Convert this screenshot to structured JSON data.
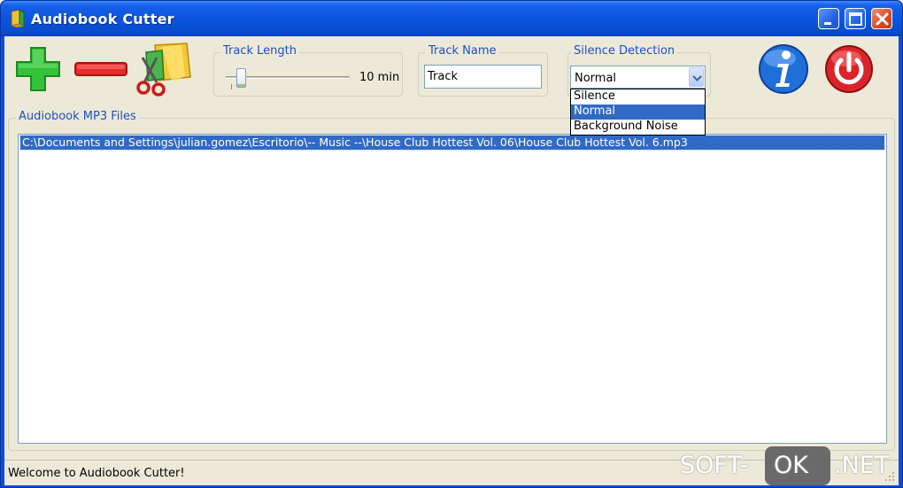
{
  "window": {
    "title": "Audiobook Cutter"
  },
  "toolbar": {
    "add_icon": "plus-icon",
    "remove_icon": "minus-icon",
    "cut_icon": "scissors-folder-icon",
    "info_icon": "info-icon",
    "exit_icon": "power-icon"
  },
  "track_length": {
    "label": "Track Length",
    "value_text": "10 min",
    "slider_fraction": 0.09
  },
  "track_name": {
    "label": "Track Name",
    "value": "Track"
  },
  "silence_detection": {
    "label": "Silence Detection",
    "selected": "Normal",
    "options": [
      "Silence",
      "Normal",
      "Background Noise"
    ],
    "selected_index": 1
  },
  "files": {
    "label": "Audiobook MP3 Files",
    "items": [
      "C:\\Documents and Settings\\julian.gomez\\Escritorio\\-- Music --\\House Club Hottest Vol. 06\\House Club Hottest Vol. 6.mp3"
    ]
  },
  "status": {
    "text": "Welcome to Audiobook Cutter!"
  },
  "watermark": {
    "left": "SOFT-",
    "middle": "OK",
    "right": ".NET"
  },
  "colors": {
    "title_bar": "#0b55de",
    "selection": "#316ac5",
    "group_label": "#1f4fbf",
    "face": "#ece9d8"
  }
}
